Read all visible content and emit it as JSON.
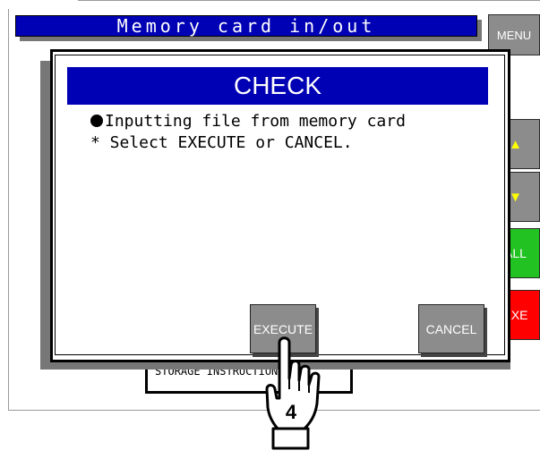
{
  "header": {
    "title": "Memory card in/out"
  },
  "sidebar": {
    "menu_label": "MENU",
    "up_label": "▲",
    "down_label": "▼",
    "all_label": "ALL",
    "exe_label": "EXE"
  },
  "background": {
    "storage_label": "STORAGE INSTRUCTIONS"
  },
  "dialog": {
    "title": "CHECK",
    "message_line1": "Inputting file from memory card",
    "message_line2": "* Select EXECUTE or CANCEL.",
    "execute_label": "EXECUTE",
    "cancel_label": "CANCEL"
  },
  "pointer": {
    "step_number": "4",
    "target": "EXECUTE"
  },
  "colors": {
    "title_bar": "#0000b4",
    "button_gray": "#8c8c8c",
    "all_green": "#22c222",
    "exe_red": "#ff0000",
    "arrow_yellow": "#ffff00"
  }
}
